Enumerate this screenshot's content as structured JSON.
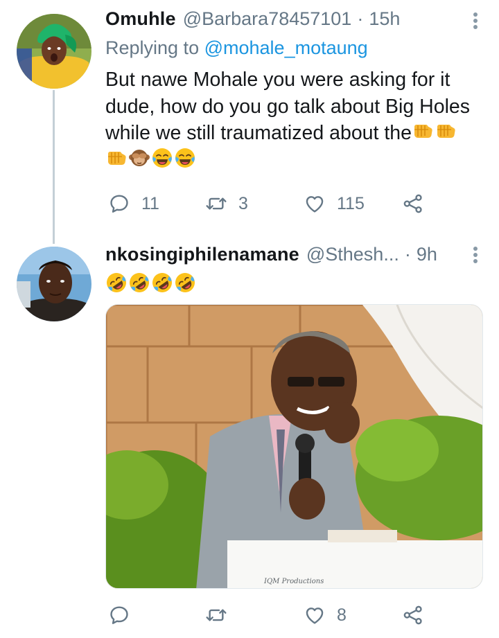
{
  "tweets": [
    {
      "display_name": "Omuhle",
      "handle": "@Barbara78457101",
      "separator": "·",
      "time": "15h",
      "replying_prefix": "Replying to",
      "replying_to": "@mohale_motaung",
      "text": "But nawe Mohale you were asking for it dude, how do you go talk about Big Holes while we still traumatized about the",
      "emojis": [
        "facepunch",
        "facepunch",
        "facepunch",
        "see-no-evil-monkey",
        "joy",
        "joy"
      ],
      "reply_count": "11",
      "retweet_count": "3",
      "like_count": "115"
    },
    {
      "display_name": "nkosingiphilenamane",
      "handle": "@Sthesh...",
      "separator": "·",
      "time": "9h",
      "emojis": [
        "rofl",
        "rofl",
        "rofl",
        "rofl"
      ],
      "media_caption": "IQM Productions",
      "reply_count": "",
      "retweet_count": "",
      "like_count": "8"
    }
  ],
  "icons": {
    "reply": "speech-bubble-icon",
    "retweet": "retweet-icon",
    "like": "heart-icon",
    "share": "share-icon",
    "more": "vertical-ellipsis-icon"
  },
  "colors": {
    "link": "#1b95e0",
    "secondary_text": "#657786",
    "thread_line": "#c4cfd6"
  }
}
